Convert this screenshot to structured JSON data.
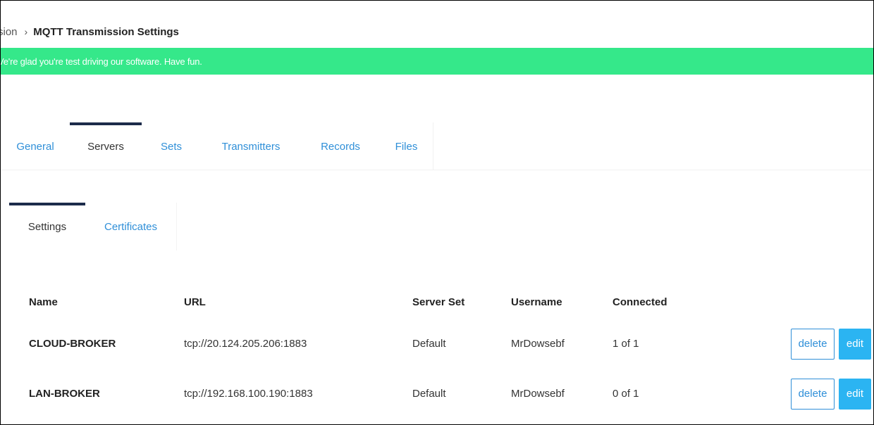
{
  "breadcrumb": {
    "previous": "sion",
    "separator": "›",
    "current": "MQTT Transmission Settings"
  },
  "banner": {
    "message": "Ve're glad you're test driving our software. Have fun.",
    "color": "#35e88a"
  },
  "main_tabs": [
    {
      "label": "General",
      "active": false
    },
    {
      "label": "Servers",
      "active": true
    },
    {
      "label": "Sets",
      "active": false
    },
    {
      "label": "Transmitters",
      "active": false
    },
    {
      "label": "Records",
      "active": false
    },
    {
      "label": "Files",
      "active": false
    }
  ],
  "sub_tabs": [
    {
      "label": "Settings",
      "active": true
    },
    {
      "label": "Certificates",
      "active": false
    }
  ],
  "table": {
    "headers": {
      "name": "Name",
      "url": "URL",
      "server_set": "Server Set",
      "username": "Username",
      "connected": "Connected"
    },
    "rows": [
      {
        "name": "CLOUD-BROKER",
        "url": "tcp://20.124.205.206:1883",
        "server_set": "Default",
        "username": "MrDowsebf",
        "connected": "1 of 1",
        "delete_label": "delete",
        "edit_label": "edit"
      },
      {
        "name": "LAN-BROKER",
        "url": "tcp://192.168.100.190:1883",
        "server_set": "Default",
        "username": "MrDowsebf",
        "connected": "0 of 1",
        "delete_label": "delete",
        "edit_label": "edit"
      }
    ]
  },
  "colors": {
    "accent": "#2f8fd8",
    "edit_button": "#2bb4f2",
    "active_tab_indicator": "#1c2b4a"
  }
}
